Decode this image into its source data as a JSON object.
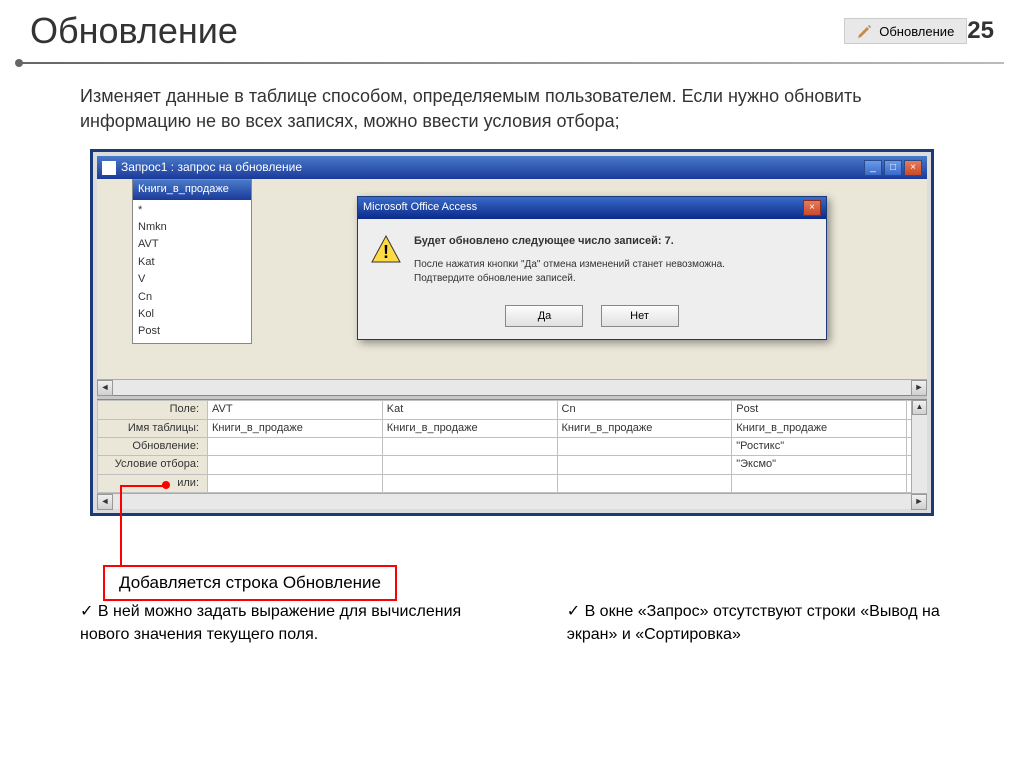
{
  "header": {
    "title": "Обновление",
    "button_label": "Обновление",
    "page_number": "25"
  },
  "description": "Изменяет данные в таблице способом, определяемым пользователем. Если нужно обновить информацию не во всех записях, можно ввести условия отбора;",
  "query_window": {
    "title": "Запрос1 : запрос на обновление",
    "table": {
      "name": "Книги_в_продаже",
      "fields": [
        "*",
        "Nmkn",
        "AVT",
        "Kat",
        "V",
        "Cn",
        "Kol",
        "Post"
      ]
    },
    "grid": {
      "row_labels": [
        "Поле:",
        "Имя таблицы:",
        "Обновление:",
        "Условие отбора:",
        "или:"
      ],
      "columns": [
        {
          "field": "AVT",
          "table": "Книги_в_продаже",
          "update": "",
          "criteria": "",
          "or": ""
        },
        {
          "field": "Kat",
          "table": "Книги_в_продаже",
          "update": "",
          "criteria": "",
          "or": ""
        },
        {
          "field": "Cn",
          "table": "Книги_в_продаже",
          "update": "",
          "criteria": "",
          "or": ""
        },
        {
          "field": "Post",
          "table": "Книги_в_продаже",
          "update": "\"Ростикс\"",
          "criteria": "\"Эксмо\"",
          "or": ""
        }
      ]
    }
  },
  "dialog": {
    "title": "Microsoft Office Access",
    "heading": "Будет обновлено следующее число записей: 7.",
    "line1": "После нажатия кнопки \"Да\" отмена изменений станет невозможна.",
    "line2": "Подтвердите обновление записей.",
    "yes": "Да",
    "no": "Нет"
  },
  "callout": "Добавляется строка Обновление",
  "bullets": {
    "left": "В ней можно задать выражение для вычисления нового значения текущего поля.",
    "right": "В окне «Запрос» отсутствуют строки «Вывод на экран» и «Сортировка»"
  }
}
